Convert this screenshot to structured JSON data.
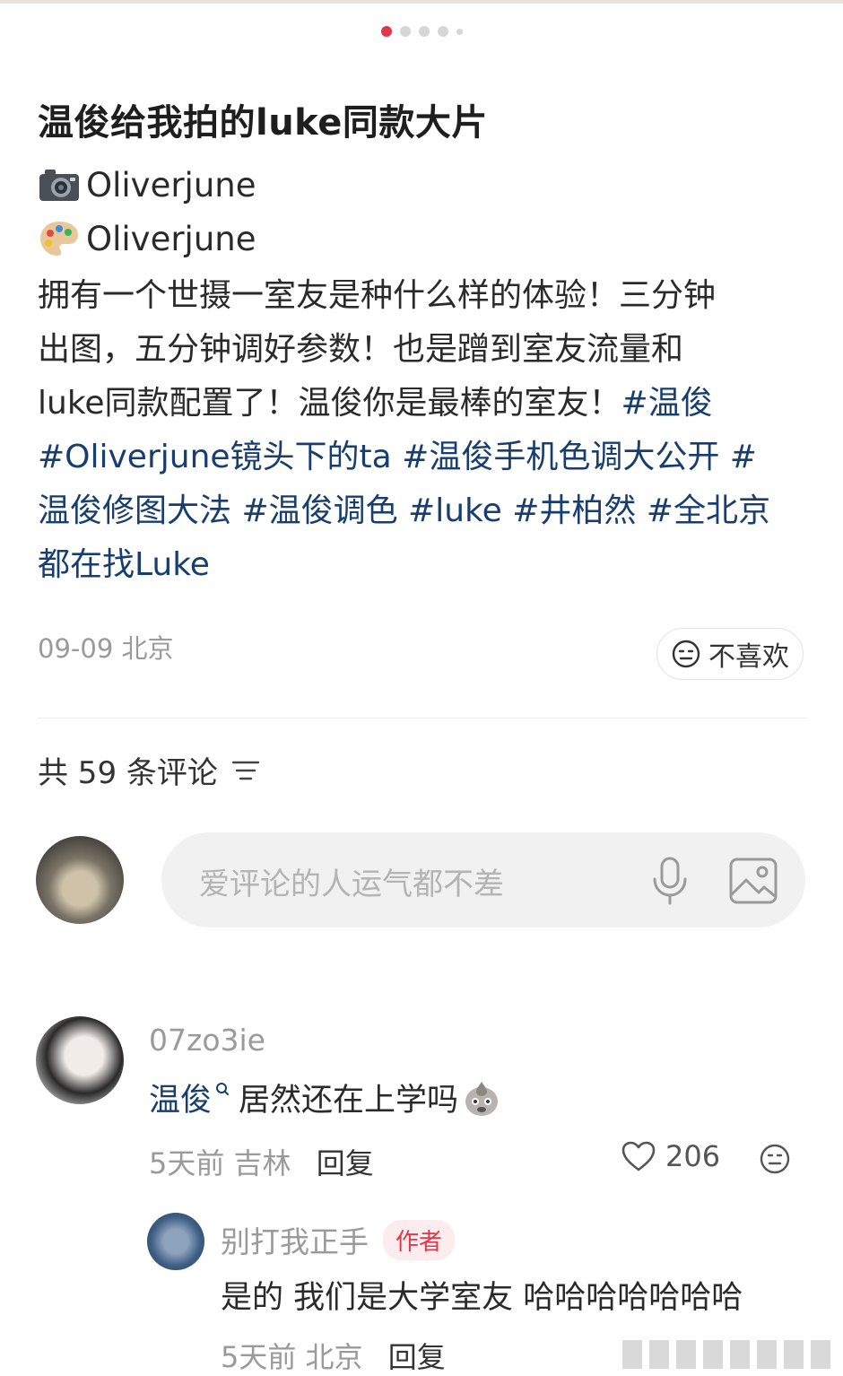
{
  "carousel": {
    "total_dots": 5,
    "active_index": 0
  },
  "post": {
    "title": "温俊给我拍的luke同款大片",
    "photo_credit": "Oliverjune",
    "edit_credit": "Oliverjune",
    "body_lines": [
      [
        {
          "t": "拥有一个世摄一室友是种什么样的体验！三分钟"
        }
      ],
      [
        {
          "t": "出图，五分钟调好参数！也是蹭到室友流量和"
        }
      ],
      [
        {
          "t": "luke同款配置了！温俊你是最棒的室友！"
        },
        {
          "t": "#温俊",
          "tag": true
        }
      ],
      [
        {
          "t": "#Oliverjune镜头下的ta #温俊手机色调大公开 #",
          "tag": true
        }
      ],
      [
        {
          "t": "温俊修图大法 #温俊调色 #luke #井柏然 #全北京",
          "tag": true
        }
      ],
      [
        {
          "t": "都在找Luke",
          "tag": true
        }
      ]
    ],
    "date_location": "09-09 北京",
    "dislike_label": "不喜欢"
  },
  "comments": {
    "count_label": "共 59 条评论",
    "input_placeholder": "爱评论的人运气都不差",
    "items": [
      {
        "user": "07zo3ie",
        "link_text": "温俊",
        "text": "居然还在上学吗",
        "time_location": "5天前 吉林",
        "reply_label": "回复",
        "likes": "206",
        "replies": [
          {
            "user": "别打我正手",
            "badge": "作者",
            "text": "是的 我们是大学室友 哈哈哈哈哈哈哈",
            "time_location": "5天前 北京",
            "reply_label": "回复"
          }
        ]
      }
    ]
  },
  "colors": {
    "accent": "#e0384a",
    "link": "#173e6e",
    "muted": "#9a9a9a"
  }
}
